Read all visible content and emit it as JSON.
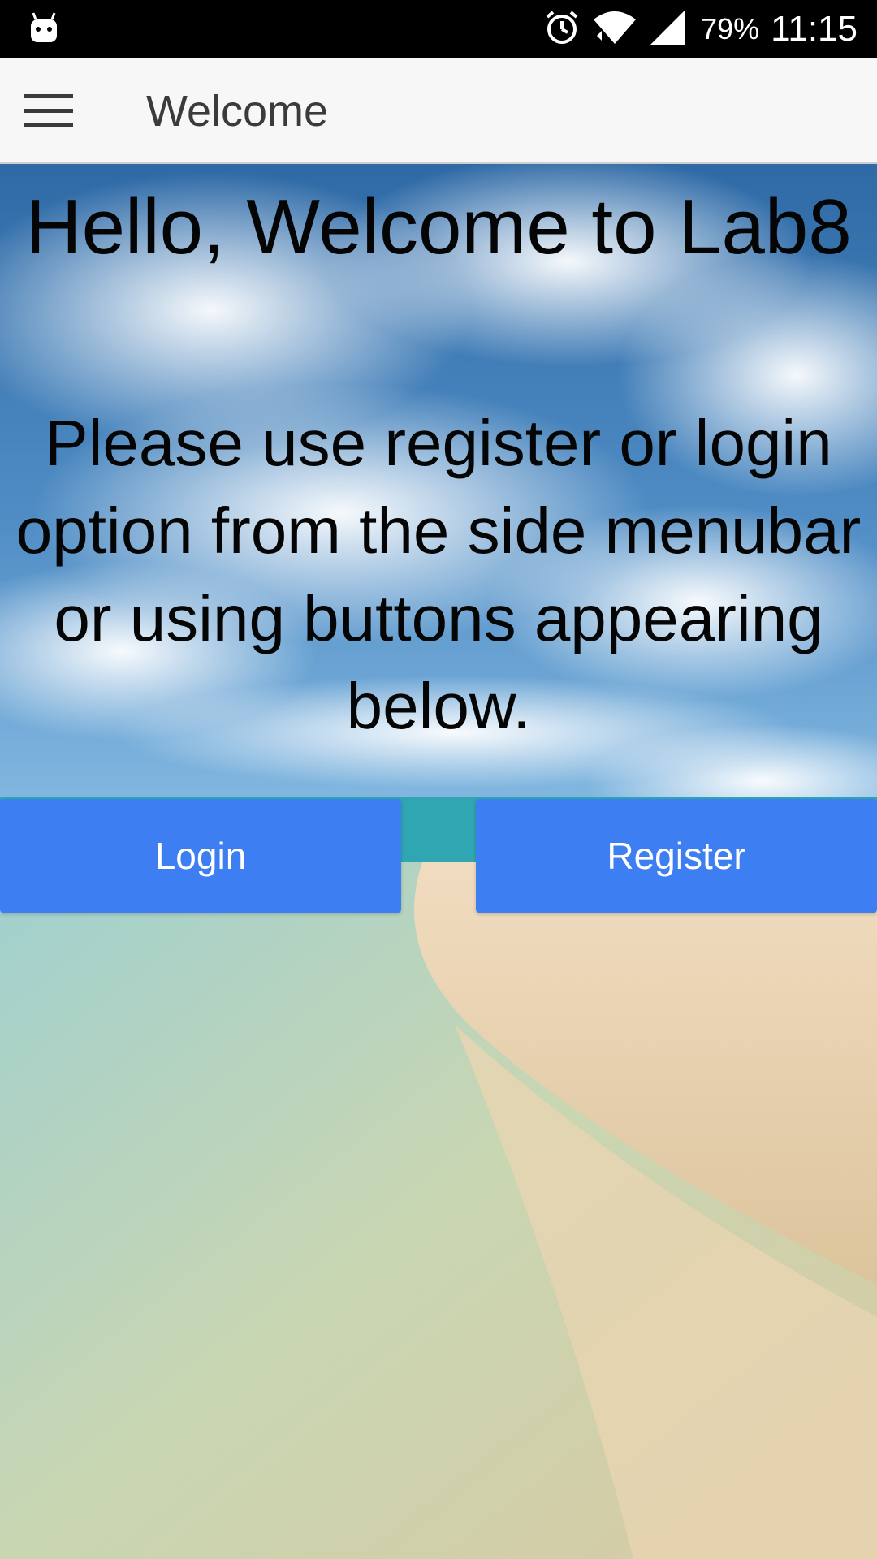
{
  "status_bar": {
    "battery": "79%",
    "time": "11:15",
    "icons": [
      "android-icon",
      "alarm-icon",
      "wifi-icon",
      "signal-icon"
    ]
  },
  "app_bar": {
    "title": "Welcome",
    "menu_icon": "hamburger-menu-icon"
  },
  "main": {
    "heading": "Hello, Welcome to Lab8",
    "subheading": "Please use register or login option from the side menubar or using buttons appearing below.",
    "login_label": "Login",
    "register_label": "Register"
  },
  "colors": {
    "button": "#3d7ef2",
    "app_bar": "#f7f7f7",
    "status_bar": "#000000",
    "text": "#050505"
  }
}
